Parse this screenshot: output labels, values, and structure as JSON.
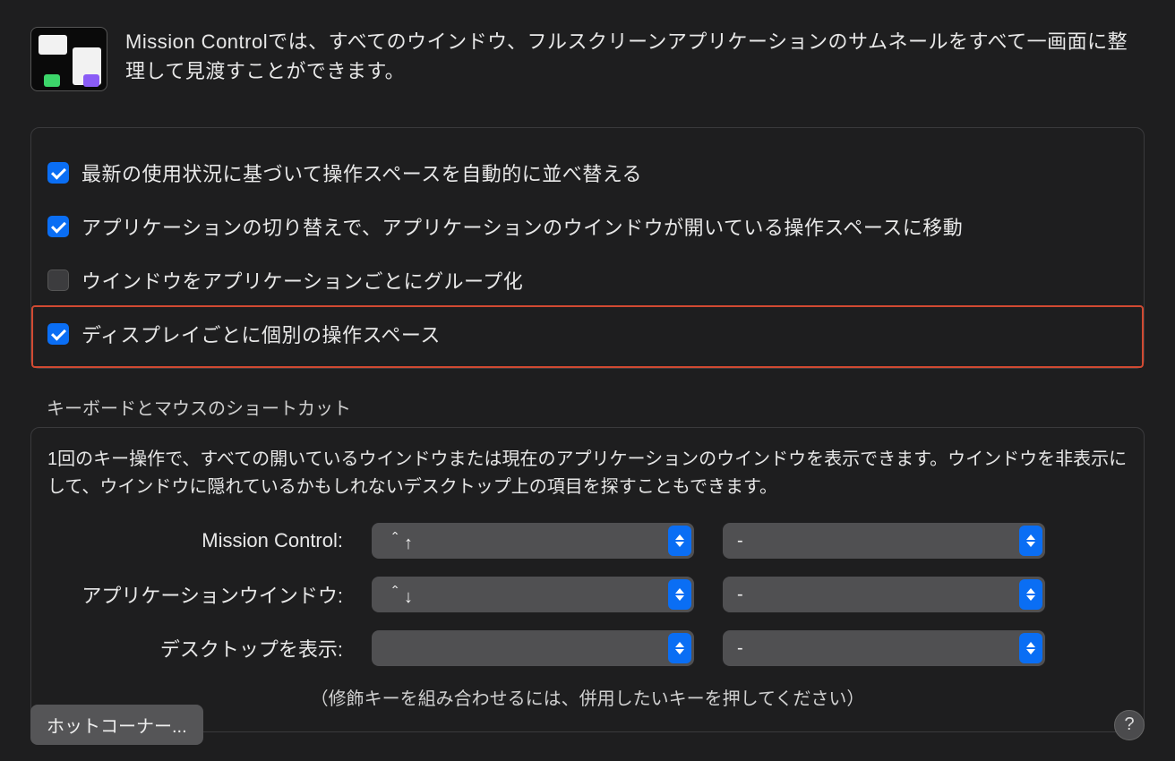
{
  "header": {
    "description": "Mission Controlでは、すべてのウインドウ、フルスクリーンアプリケーションのサムネールをすべて一画面に整理して見渡すことができます。"
  },
  "options": [
    {
      "label": "最新の使用状況に基づいて操作スペースを自動的に並べ替える",
      "checked": true,
      "highlight": false
    },
    {
      "label": "アプリケーションの切り替えで、アプリケーションのウインドウが開いている操作スペースに移動",
      "checked": true,
      "highlight": false
    },
    {
      "label": "ウインドウをアプリケーションごとにグループ化",
      "checked": false,
      "highlight": false
    },
    {
      "label": "ディスプレイごとに個別の操作スペース",
      "checked": true,
      "highlight": true
    }
  ],
  "shortcuts": {
    "section_label": "キーボードとマウスのショートカット",
    "description": "1回のキー操作で、すべての開いているウインドウまたは現在のアプリケーションのウインドウを表示できます。ウインドウを非表示にして、ウインドウに隠れているかもしれないデスクトップ上の項目を探すこともできます。",
    "rows": [
      {
        "label": "Mission Control:",
        "primary": "＾↑",
        "secondary": "-"
      },
      {
        "label": "アプリケーションウインドウ:",
        "primary": "＾↓",
        "secondary": "-"
      },
      {
        "label": "デスクトップを表示:",
        "primary": "",
        "secondary": "-"
      }
    ],
    "hint": "（修飾キーを組み合わせるには、併用したいキーを押してください）"
  },
  "footer": {
    "hot_corners": "ホットコーナー...",
    "help": "?"
  }
}
